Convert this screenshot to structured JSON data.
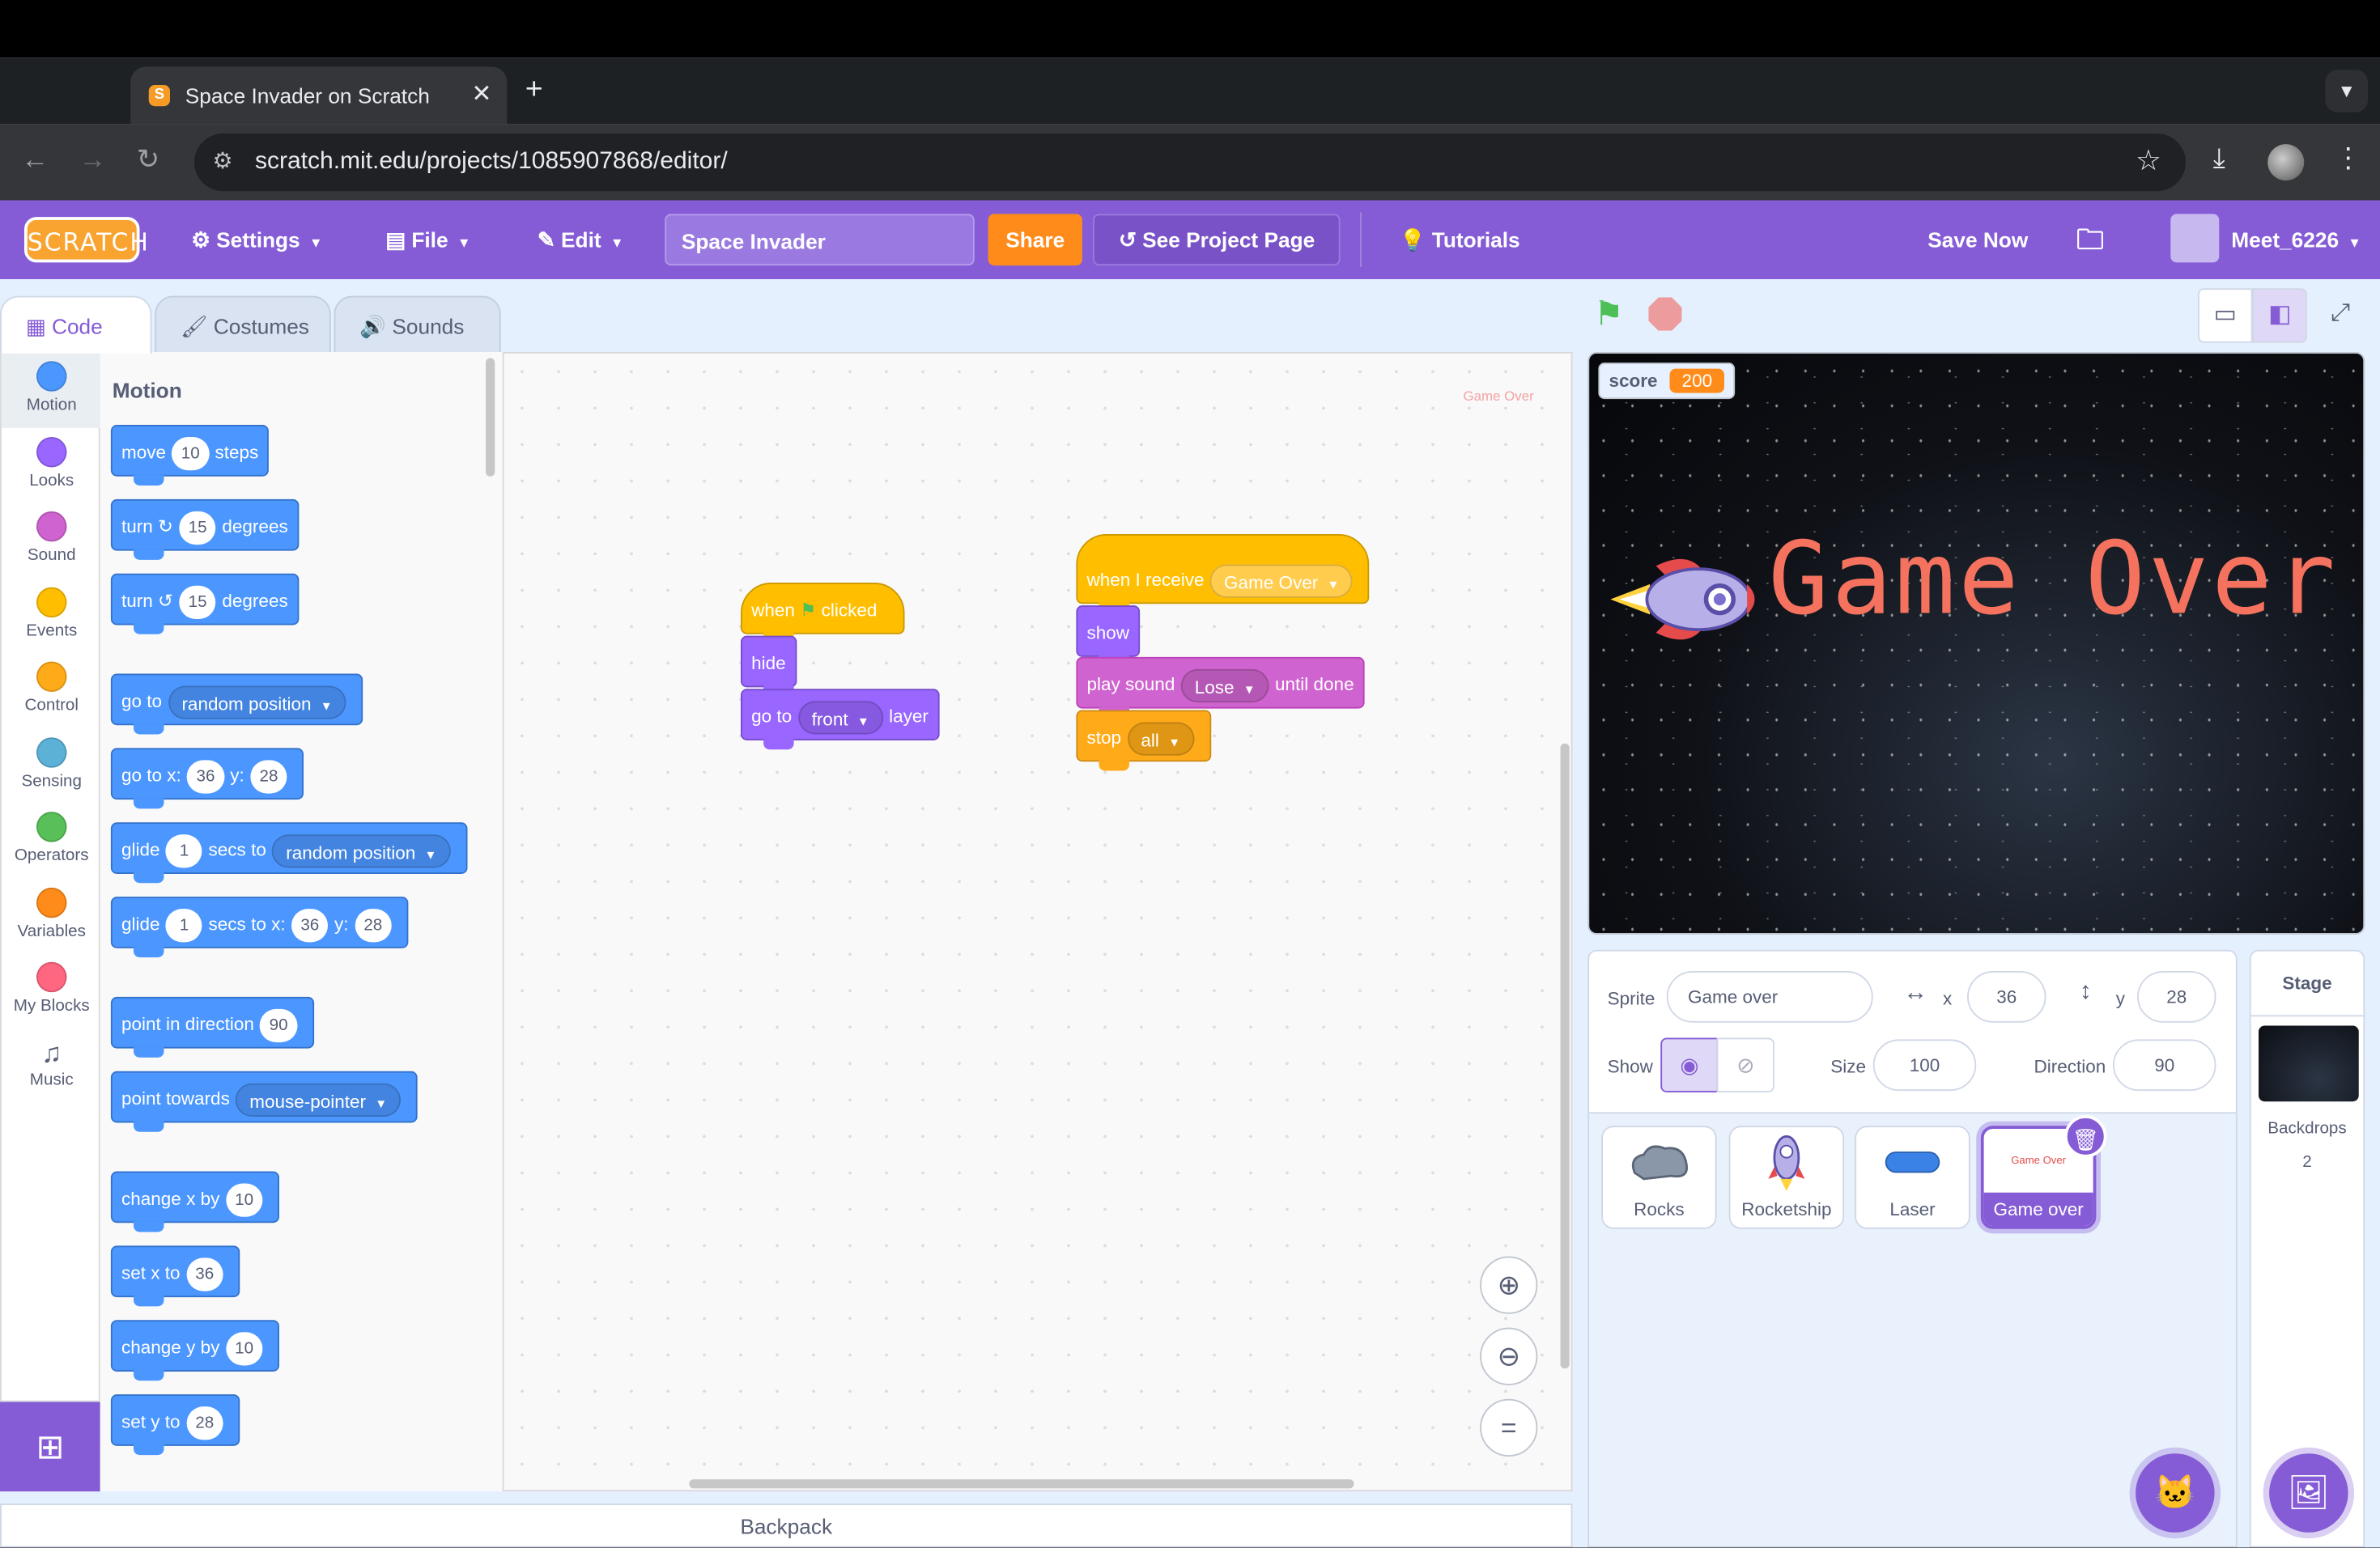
{
  "browser": {
    "tab_title": "Space Invader on Scratch",
    "url": "scratch.mit.edu/projects/1085907868/editor/"
  },
  "menubar": {
    "logo": "SCRATCH",
    "settings": "Settings",
    "file": "File",
    "edit": "Edit",
    "project_title": "Space Invader",
    "share": "Share",
    "see_project": "See Project Page",
    "tutorials": "Tutorials",
    "save_now": "Save Now",
    "username": "Meet_6226"
  },
  "editor_tabs": {
    "code": "Code",
    "costumes": "Costumes",
    "sounds": "Sounds"
  },
  "categories": [
    {
      "label": "Motion",
      "color": "#4c97ff"
    },
    {
      "label": "Looks",
      "color": "#9966ff"
    },
    {
      "label": "Sound",
      "color": "#cf63cf"
    },
    {
      "label": "Events",
      "color": "#ffbf00"
    },
    {
      "label": "Control",
      "color": "#ffab19"
    },
    {
      "label": "Sensing",
      "color": "#5cb1d6"
    },
    {
      "label": "Operators",
      "color": "#59c059"
    },
    {
      "label": "Variables",
      "color": "#ff8c1a"
    },
    {
      "label": "My Blocks",
      "color": "#ff6680"
    },
    {
      "label": "Music",
      "icon": "music-notes-icon"
    }
  ],
  "palette": {
    "heading": "Motion",
    "move": {
      "a": "move",
      "n": "10",
      "b": "steps"
    },
    "turn_right": {
      "a": "turn",
      "n": "15",
      "b": "degrees"
    },
    "turn_left": {
      "a": "turn",
      "n": "15",
      "b": "degrees"
    },
    "goto": {
      "a": "go to",
      "dd": "random position"
    },
    "gotoxy": {
      "a": "go to x:",
      "x": "36",
      "b": "y:",
      "y": "28"
    },
    "glide_to": {
      "a": "glide",
      "n": "1",
      "b": "secs to",
      "dd": "random position"
    },
    "glide_xy": {
      "a": "glide",
      "n": "1",
      "b": "secs to x:",
      "x": "36",
      "c": "y:",
      "y": "28"
    },
    "point_dir": {
      "a": "point in direction",
      "n": "90"
    },
    "point_towards": {
      "a": "point towards",
      "dd": "mouse-pointer"
    },
    "change_x": {
      "a": "change x by",
      "n": "10"
    },
    "set_x": {
      "a": "set x to",
      "n": "36"
    },
    "change_y": {
      "a": "change y by",
      "n": "10"
    },
    "set_y": {
      "a": "set y to",
      "n": "28"
    }
  },
  "workspace": {
    "corner_label": "Game Over",
    "script1": {
      "when": "when",
      "clicked": "clicked",
      "hide": "hide",
      "goto": "go to",
      "front": "front",
      "layer": "layer"
    },
    "script2": {
      "when_receive": "when I receive",
      "message": "Game Over",
      "show": "show",
      "play_sound": "play sound",
      "sound": "Lose",
      "until_done": "until done",
      "stop": "stop",
      "all": "all"
    },
    "backpack": "Backpack"
  },
  "stage": {
    "variable_name": "score",
    "variable_value": "200",
    "game_over_text": "Game Over"
  },
  "sprite_info": {
    "sprite_label": "Sprite",
    "sprite_name": "Game over",
    "x_label": "x",
    "x": "36",
    "y_label": "y",
    "y": "28",
    "show_label": "Show",
    "size_label": "Size",
    "size": "100",
    "direction_label": "Direction",
    "direction": "90"
  },
  "sprites": [
    {
      "name": "Rocks"
    },
    {
      "name": "Rocketship"
    },
    {
      "name": "Laser"
    },
    {
      "name": "Game over",
      "selected": true,
      "thumb_text": "Game Over"
    }
  ],
  "stage_panel": {
    "title": "Stage",
    "backdrops_label": "Backdrops",
    "backdrops_count": "2"
  }
}
